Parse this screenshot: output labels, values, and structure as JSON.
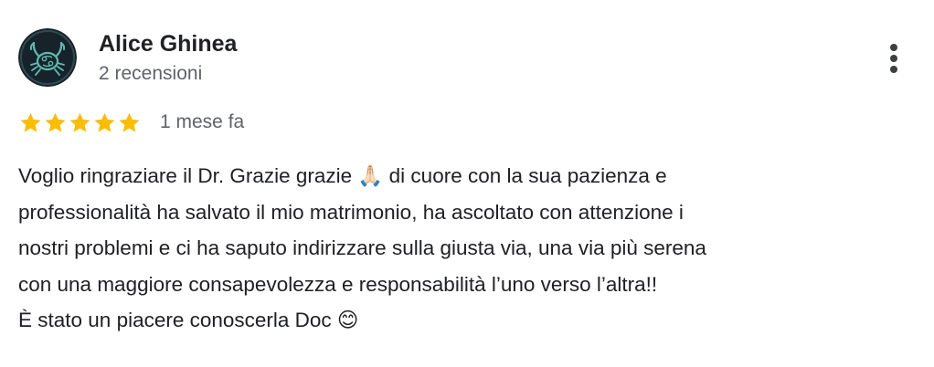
{
  "reviewer": {
    "name": "Alice Ghinea",
    "review_count": "2 recensioni",
    "avatar_icon": "cancer-zodiac-crab-icon",
    "avatar_colors": {
      "background": "#17232a",
      "ring": "#2f4b52",
      "crab": "#5fb9b0"
    }
  },
  "menu": {
    "more_icon": "more-vertical-icon"
  },
  "rating": {
    "stars": 5,
    "max_stars": 5,
    "star_color": "#fbbc04",
    "date": "1 mese fa"
  },
  "review": {
    "lines": [
      "Voglio ringraziare il Dr. Grazie grazie 🙏🏻 di cuore con la sua pazienza e",
      "professionalità ha salvato il mio matrimonio, ha ascoltato con attenzione i",
      "nostri problemi e ci ha saputo indirizzare sulla giusta via, una via più serena",
      "con una maggiore consapevolezza e responsabilità l’uno verso l’altra!!",
      "È stato un piacere conoscerla Doc 😊"
    ]
  }
}
